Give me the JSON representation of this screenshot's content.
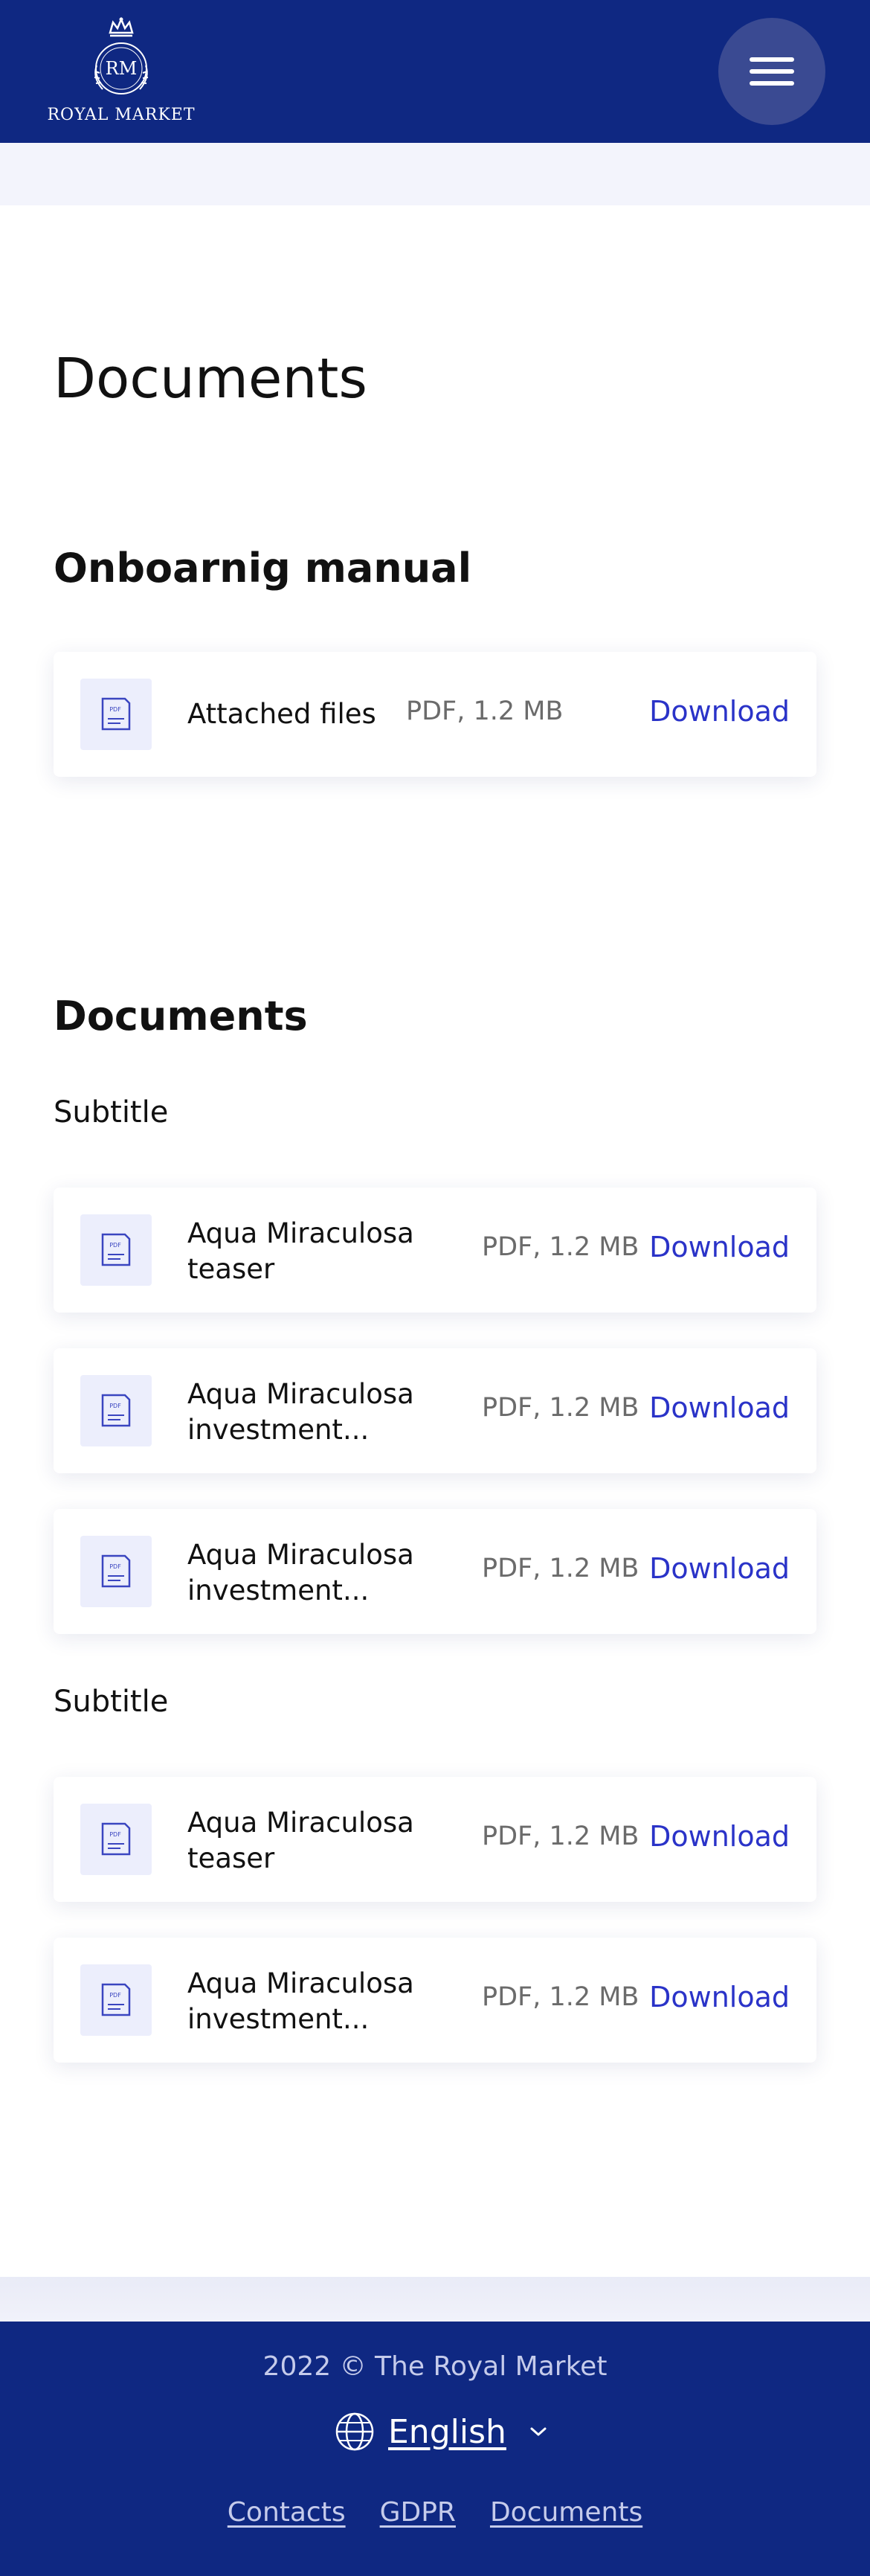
{
  "header": {
    "logo_monogram": "RM",
    "logo_text": "ROYAL MARKET",
    "menu_icon": "hamburger-menu-icon"
  },
  "main": {
    "page_title": "Documents",
    "sections": [
      {
        "title": "Onboarnig manual",
        "files": [
          {
            "name": "Attached files",
            "meta": "PDF, 1.2 MB",
            "download": "Download",
            "icon": "pdf-file-icon"
          }
        ]
      },
      {
        "title": "Documents",
        "groups": [
          {
            "subtitle": "Subtitle",
            "files": [
              {
                "name": "Aqua Miraculosa\nteaser",
                "meta": "PDF, 1.2 MB",
                "download": "Download",
                "icon": "pdf-file-icon"
              },
              {
                "name": "Aqua Miraculosa\ninvestment...",
                "meta": "PDF, 1.2 MB",
                "download": "Download",
                "icon": "pdf-file-icon"
              },
              {
                "name": "Aqua Miraculosa\ninvestment...",
                "meta": "PDF, 1.2 MB",
                "download": "Download",
                "icon": "pdf-file-icon"
              }
            ]
          },
          {
            "subtitle": "Subtitle",
            "files": [
              {
                "name": "Aqua Miraculosa\nteaser",
                "meta": "PDF, 1.2 MB",
                "download": "Download",
                "icon": "pdf-file-icon"
              },
              {
                "name": "Aqua Miraculosa\ninvestment...",
                "meta": "PDF, 1.2 MB",
                "download": "Download",
                "icon": "pdf-file-icon"
              }
            ]
          }
        ]
      }
    ]
  },
  "footer": {
    "copyright": "2022 © The Royal Market",
    "language": "English",
    "links": [
      "Contacts",
      "GDPR",
      "Documents"
    ]
  },
  "colors": {
    "brand_navy": "#0f2882",
    "accent_blue": "#2a33c8",
    "page_tint": "#f3f4fc"
  }
}
